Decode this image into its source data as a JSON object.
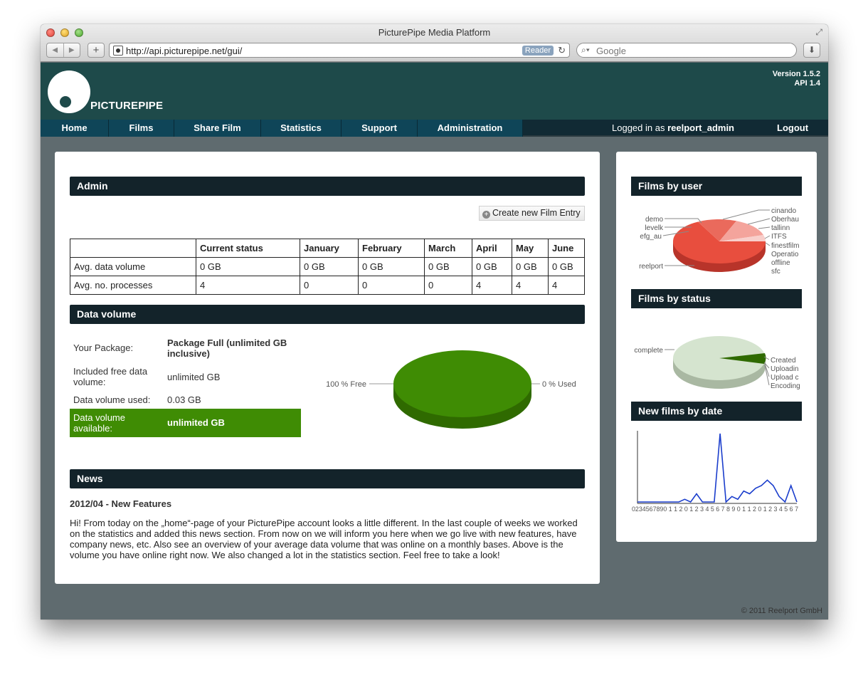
{
  "browser": {
    "window_title": "PicturePipe Media Platform",
    "url": "http://api.picturepipe.net/gui/",
    "reader_label": "Reader",
    "search_placeholder": "Google"
  },
  "site": {
    "logo_text": "PICTUREPIPE",
    "version": "Version 1.5.2",
    "api": "API 1.4"
  },
  "menu": {
    "items": [
      "Home",
      "Films",
      "Share Film",
      "Statistics",
      "Support",
      "Administration"
    ],
    "logged_prefix": "Logged in as",
    "username": "reelport_admin",
    "logout": "Logout"
  },
  "admin": {
    "title": "Admin",
    "create_button": "Create new Film Entry",
    "table": {
      "headers": [
        "",
        "Current status",
        "January",
        "February",
        "March",
        "April",
        "May",
        "June"
      ],
      "rows": [
        [
          "Avg. data volume",
          "0 GB",
          "0 GB",
          "0 GB",
          "0 GB",
          "0 GB",
          "0 GB",
          "0 GB"
        ],
        [
          "Avg. no. processes",
          "4",
          "0",
          "0",
          "0",
          "4",
          "4",
          "4"
        ]
      ]
    }
  },
  "data_volume": {
    "title": "Data volume",
    "rows": [
      {
        "label": "Your Package:",
        "value": "Package Full (unlimited GB inclusive)"
      },
      {
        "label": "Included free data volume:",
        "value": "unlimited GB"
      },
      {
        "label": "Data volume used:",
        "value": "0.03 GB"
      },
      {
        "label": "Data volume available:",
        "value": "unlimited GB"
      }
    ],
    "free_label": "100 % Free",
    "used_label": "0 % Used"
  },
  "news": {
    "title": "News",
    "item_title": "2012/04 - New Features",
    "body": "Hi! From today on the „home“-page of your PicturePipe account looks a little different. In the last couple of weeks we worked on the statistics and added this news section. From now on we will inform you here when we go live with new features, have company news, etc. Also see an overview of your average data volume that was online on a monthly bases. Above is the volume you have online right now. We also changed a lot in the statistics section. Feel free to take a look!"
  },
  "sidebar": {
    "films_by_user": {
      "title": "Films by user",
      "left_labels": [
        "demo",
        "levelk",
        "efg_au",
        "reelport"
      ],
      "right_labels": [
        "cinando",
        "Oberhau",
        "tallinn",
        "ITFS",
        "finestfilm",
        "Operatio",
        "offline",
        "sfc"
      ]
    },
    "films_by_status": {
      "title": "Films by status",
      "left_labels": [
        "complete"
      ],
      "right_labels": [
        "Created",
        "Uploadin",
        "Upload c",
        "Encoding"
      ]
    },
    "new_films_by_date": {
      "title": "New films by date",
      "x_labels": "0234567890 1 1 2 0 1 2 3 4 5 6 7 8 9 0 1 1 2 0 1 2 3 4 5 6 7"
    }
  },
  "footer": "© 2011 Reelport GmbH",
  "chart_data": [
    {
      "type": "pie",
      "title": "",
      "labels": [
        "100 % Free",
        "0 % Used"
      ],
      "values": [
        100,
        0
      ],
      "colors": [
        "#3f8c04",
        "#2f6a00"
      ]
    },
    {
      "type": "pie",
      "title": "Films by user",
      "labels": [
        "reelport",
        "demo",
        "levelk",
        "efg_au",
        "cinando",
        "Oberhau",
        "tallinn",
        "ITFS",
        "finestfilm",
        "Operatio",
        "offline",
        "sfc"
      ],
      "values": [
        62,
        16,
        1,
        1,
        1,
        1,
        1,
        10,
        2,
        1,
        1,
        1
      ]
    },
    {
      "type": "pie",
      "title": "Films by status",
      "labels": [
        "complete",
        "Created",
        "Uploadin",
        "Upload c",
        "Encoding"
      ],
      "values": [
        95,
        4,
        0.4,
        0.3,
        0.3
      ]
    },
    {
      "type": "line",
      "title": "New films by date",
      "values": [
        0,
        0,
        0,
        0,
        0,
        0,
        0,
        0,
        1,
        0,
        3,
        0,
        0,
        0,
        25,
        0,
        2,
        1,
        4,
        3,
        5,
        6,
        8,
        6,
        2,
        0,
        6,
        0
      ]
    }
  ]
}
